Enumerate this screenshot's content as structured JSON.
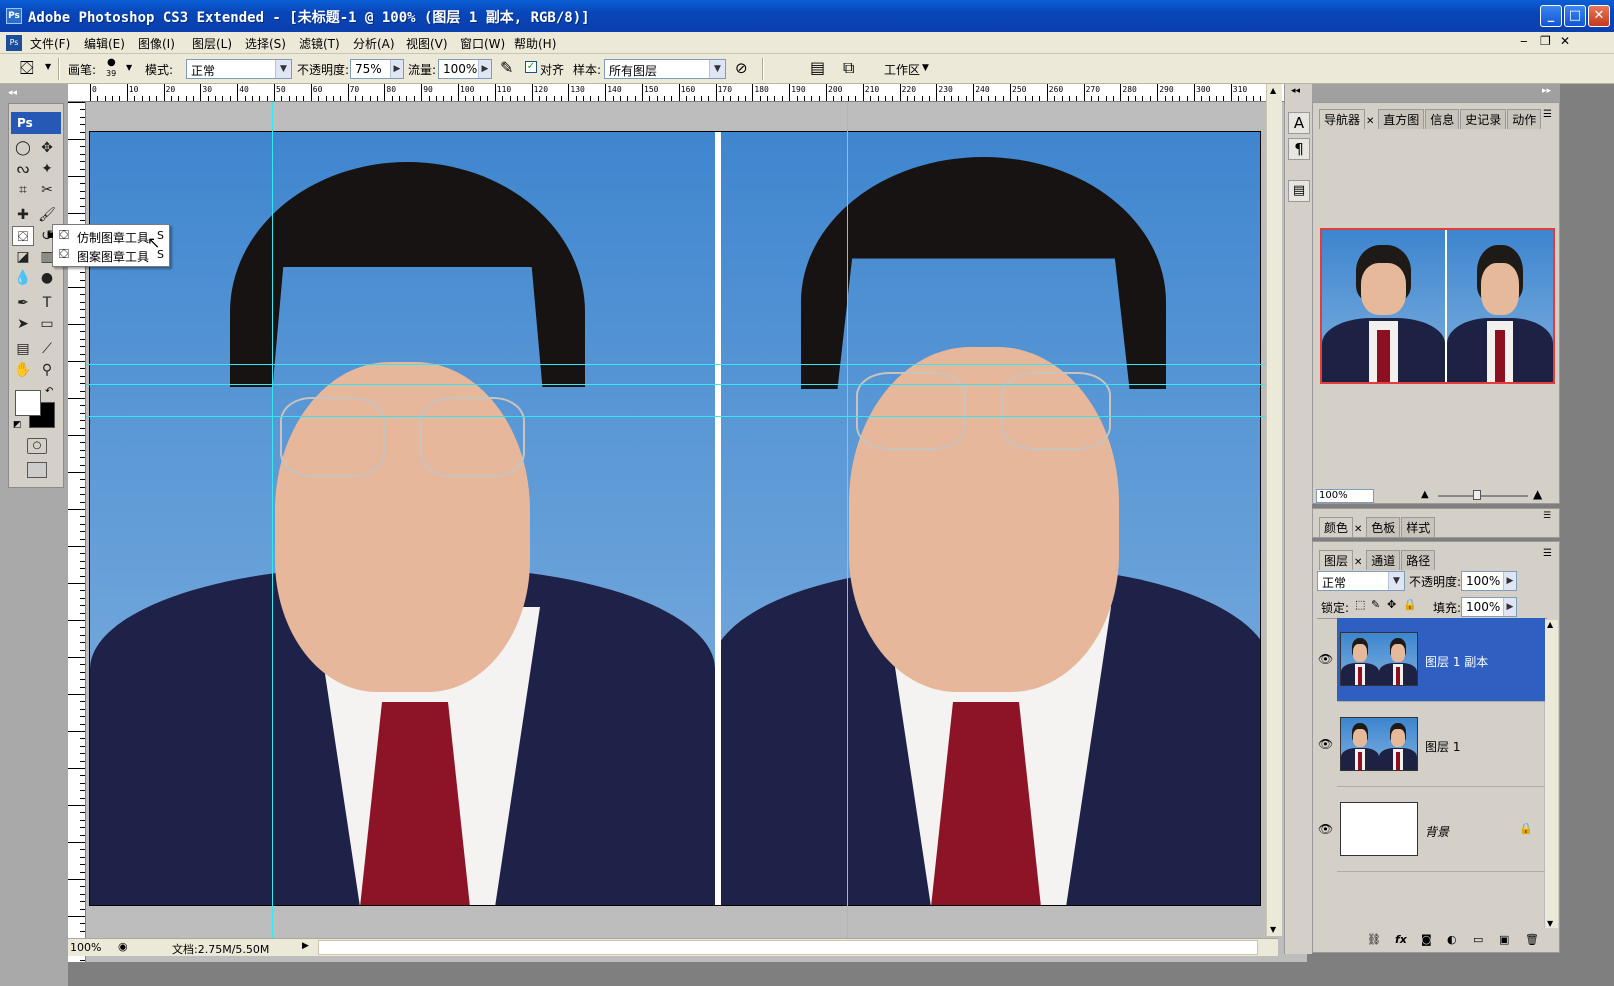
{
  "window": {
    "title": "Adobe Photoshop CS3 Extended - [未标题-1 @ 100% (图层 1 副本, RGB/8)]",
    "app_icon": "Ps"
  },
  "menu": [
    "文件(F)",
    "编辑(E)",
    "图像(I)",
    "图层(L)",
    "选择(S)",
    "滤镜(T)",
    "分析(A)",
    "视图(V)",
    "窗口(W)",
    "帮助(H)"
  ],
  "options": {
    "brush_label": "画笔:",
    "brush_size": "39",
    "mode_label": "模式:",
    "mode_value": "正常",
    "opacity_label": "不透明度:",
    "opacity_value": "75%",
    "flow_label": "流量:",
    "flow_value": "100%",
    "aligned_label": "对齐",
    "aligned_checked": true,
    "sample_label": "样本:",
    "sample_value": "所有图层",
    "workspace_label": "工作区"
  },
  "toolbox": {
    "logo": "Ps"
  },
  "flyout": {
    "items": [
      {
        "label": "仿制图章工具",
        "shortcut": "S",
        "selected": true
      },
      {
        "label": "图案图章工具",
        "shortcut": "S",
        "selected": false
      }
    ]
  },
  "ruler_h": [
    "0",
    "10",
    "20",
    "30",
    "40",
    "50",
    "60",
    "70",
    "80",
    "90",
    "100",
    "110",
    "120",
    "130",
    "140",
    "150",
    "160",
    "170",
    "180",
    "190",
    "200",
    "210",
    "220",
    "230",
    "240",
    "250",
    "260",
    "270",
    "280",
    "290",
    "300",
    "310"
  ],
  "status": {
    "zoom": "100%",
    "doc": "文档:2.75M/5.50M"
  },
  "navigator": {
    "tabs": [
      "导航器",
      "直方图",
      "信息",
      "史记录",
      "动作"
    ],
    "zoom": "100%"
  },
  "color_panel": {
    "tabs": [
      "颜色",
      "色板",
      "样式"
    ]
  },
  "layers_panel": {
    "tabs": [
      "图层",
      "通道",
      "路径"
    ],
    "blend_mode": "正常",
    "opacity_label": "不透明度:",
    "opacity_value": "100%",
    "lock_label": "锁定:",
    "fill_label": "填充:",
    "fill_value": "100%",
    "layers": [
      {
        "name": "图层 1 副本",
        "selected": true,
        "visible": true
      },
      {
        "name": "图层 1",
        "selected": false,
        "visible": true
      },
      {
        "name": "背景",
        "selected": false,
        "visible": true,
        "locked": true
      }
    ]
  },
  "colors": {
    "titlebar": "#0846b8",
    "guide": "#34e8f0",
    "selected_layer": "#2f5fc0",
    "sky": "#5a97d4"
  }
}
